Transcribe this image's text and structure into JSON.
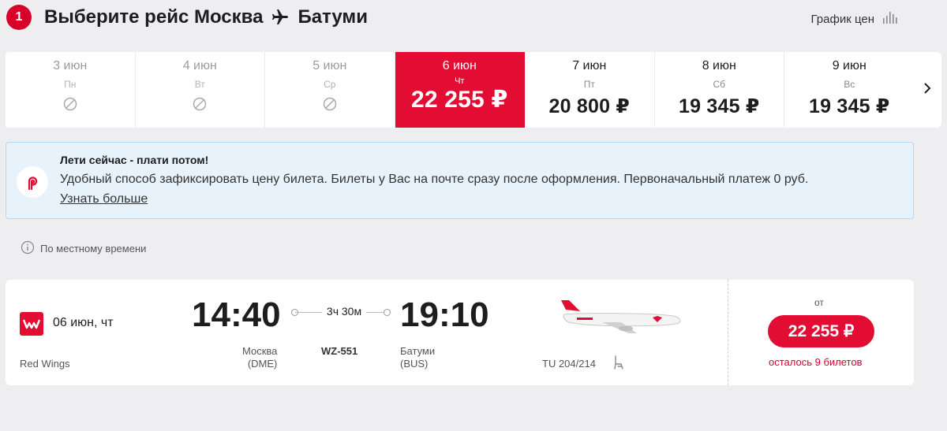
{
  "header": {
    "step_number": "1",
    "title_prefix": "Выберите рейс Москва",
    "title_destination": "Батуми",
    "price_chart_label": "График цен"
  },
  "dates": [
    {
      "date": "3 июн",
      "weekday": "Пн",
      "price": null,
      "available": false,
      "selected": false
    },
    {
      "date": "4 июн",
      "weekday": "Вт",
      "price": null,
      "available": false,
      "selected": false
    },
    {
      "date": "5 июн",
      "weekday": "Ср",
      "price": null,
      "available": false,
      "selected": false
    },
    {
      "date": "6 июн",
      "weekday": "Чт",
      "price": "22 255 ₽",
      "available": true,
      "selected": true
    },
    {
      "date": "7 июн",
      "weekday": "Пт",
      "price": "20 800 ₽",
      "available": true,
      "selected": false
    },
    {
      "date": "8 июн",
      "weekday": "Сб",
      "price": "19 345 ₽",
      "available": true,
      "selected": false
    },
    {
      "date": "9 июн",
      "weekday": "Вс",
      "price": "19 345 ₽",
      "available": true,
      "selected": false
    }
  ],
  "promo": {
    "title": "Лети сейчас - плати потом!",
    "text": "Удобный способ зафиксировать цену билета. Билеты у Вас на почте сразу после оформления. Первоначальный платеж 0 руб.",
    "link": "Узнать больше"
  },
  "local_time_note": "По местному времени",
  "flight": {
    "date": "06 июн, чт",
    "airline": "Red Wings",
    "departure_time": "14:40",
    "arrival_time": "19:10",
    "duration": "3ч 30м",
    "departure_city": "Москва",
    "departure_code": "(DME)",
    "arrival_city": "Батуми",
    "arrival_code": "(BUS)",
    "flight_number": "WZ-551",
    "aircraft": "TU 204/214",
    "price_prefix": "от",
    "price": "22 255 ₽",
    "seats_left": "осталось 9 билетов"
  },
  "colors": {
    "accent": "#e30c33",
    "promo_bg": "#e8f2fb",
    "page_bg": "#eeeef0"
  }
}
